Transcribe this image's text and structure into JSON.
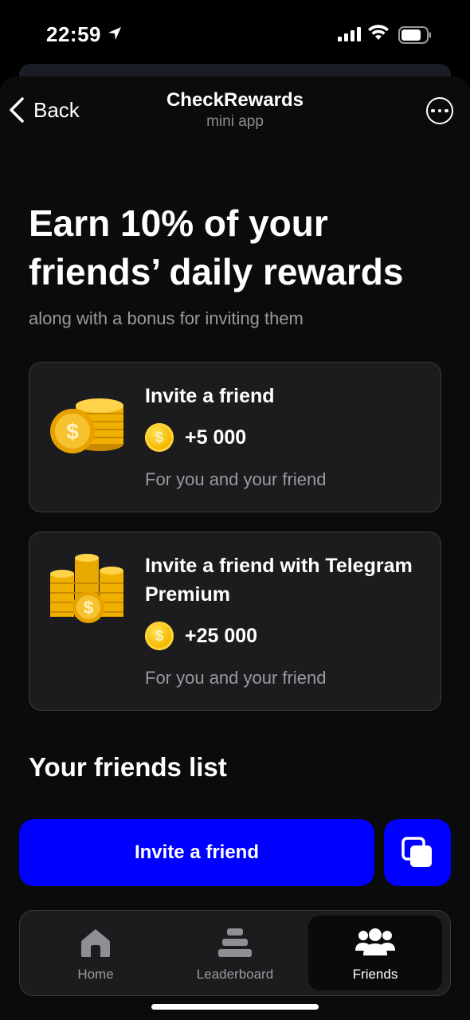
{
  "status_bar": {
    "time": "22:59"
  },
  "nav": {
    "back_label": "Back",
    "title": "CheckRewards",
    "subtitle": "mini app"
  },
  "hero": {
    "headline": "Earn 10% of your friends’ daily rewards",
    "subheadline": "along with a bonus for inviting them"
  },
  "cards": [
    {
      "title": "Invite a friend",
      "reward": "+5 000",
      "note": "For you and your friend",
      "icon": "coin-stack-icon"
    },
    {
      "title": "Invite a friend with Telegram Premium",
      "reward": "+25 000",
      "note": "For you and your friend",
      "icon": "coin-stacks-icon"
    }
  ],
  "friends_section": {
    "title": "Your friends list"
  },
  "actions": {
    "invite_label": "Invite a friend",
    "copy_icon": "copy-icon"
  },
  "tabbar": {
    "items": [
      {
        "label": "Home",
        "icon": "home-icon",
        "active": false
      },
      {
        "label": "Leaderboard",
        "icon": "leaderboard-icon",
        "active": false
      },
      {
        "label": "Friends",
        "icon": "friends-icon",
        "active": true
      }
    ]
  },
  "colors": {
    "accent": "#0000ff",
    "card_bg": "#1c1c1e",
    "coin": "#f5b800"
  }
}
